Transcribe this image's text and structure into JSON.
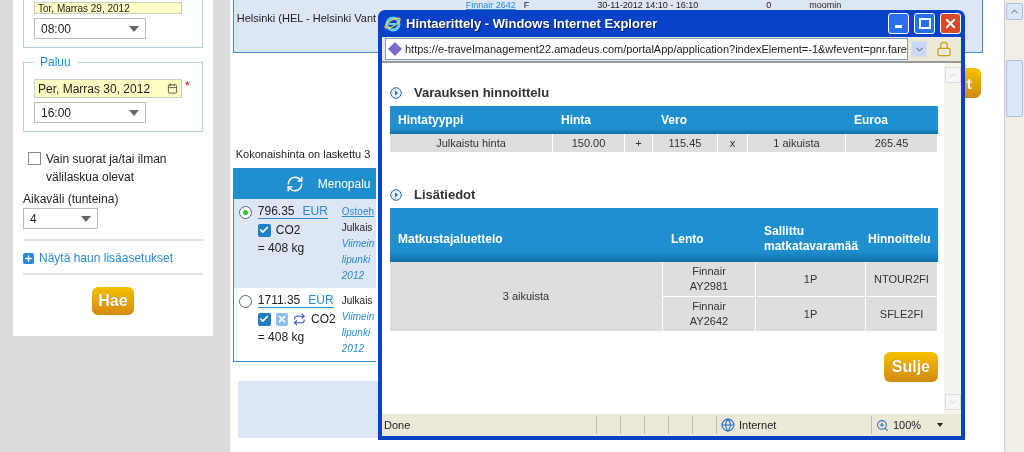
{
  "search_panel": {
    "departure": {
      "date": "Tor, Marras 29, 2012",
      "time": "08:00"
    },
    "return": {
      "legend": "Paluu",
      "date": "Per, Marras 30, 2012",
      "required_mark": "*",
      "time": "16:00"
    },
    "direct_only": {
      "label": "Vain suorat ja/tai ilman välilaskua olevat",
      "checked": false
    },
    "interval": {
      "label": "Aikaväli (tunteina)",
      "value": "4"
    },
    "advanced_link": "Näytä haun lisäasetukset",
    "search_button": "Hae"
  },
  "results": {
    "top_row": {
      "flight": "Finnair 2642",
      "class": "F",
      "time": "30-11-2012  14:10 - 16:10",
      "stops": "0",
      "user": "moomin"
    },
    "route": "Helsinki (HEL - Helsinki Vant",
    "side_button": "t",
    "total_note": "Kokonaishinta on laskettu 3",
    "header": "Menopalu",
    "offers": [
      {
        "selected": true,
        "price": "796.35",
        "currency": "EUR",
        "badges": [
          {
            "kind": "check"
          }
        ],
        "co2": "CO2",
        "weight": "= 408 kg",
        "lines": [
          {
            "kind": "link",
            "text": "Ostoeh"
          },
          {
            "kind": "plain",
            "text": "Julkais"
          },
          {
            "kind": "note",
            "text": "Viimein"
          },
          {
            "kind": "note",
            "text": "lipunki"
          },
          {
            "kind": "note",
            "text": "2012"
          }
        ]
      },
      {
        "selected": false,
        "price": "1711.35",
        "currency": "EUR",
        "badges": [
          {
            "kind": "check"
          },
          {
            "kind": "cross"
          },
          {
            "kind": "swap"
          }
        ],
        "co2": "CO2",
        "weight": "= 408 kg",
        "lines": [
          {
            "kind": "plain",
            "text": "Julkais"
          },
          {
            "kind": "note",
            "text": "Viimein"
          },
          {
            "kind": "note",
            "text": "lipunki"
          },
          {
            "kind": "note",
            "text": "2012"
          }
        ]
      }
    ]
  },
  "popup": {
    "title": "Hintaerittely - Windows Internet Explorer",
    "url": "https://e-travelmanagement22.amadeus.com/portalApp/application?indexElement=-1&wfevent=pnr.fare",
    "pricing": {
      "title": "Varauksen hinnoittelu",
      "columns": [
        "Hintatyyppi",
        "Hinta",
        "",
        "Vero",
        "",
        "",
        "Euroa"
      ],
      "rows": [
        [
          "Julkaistu hinta",
          "150.00",
          "+",
          "115.45",
          "x",
          "1  aikuista",
          "265.45"
        ]
      ]
    },
    "details": {
      "title": "Lisätiedot",
      "columns": [
        "Matkustajaluettelo",
        "Lento",
        "Sallittu matkatavaramää",
        "Hinnoittelu"
      ],
      "passengers": "3  aikuista",
      "segments": [
        {
          "flight": "Finnair AY2981",
          "baggage": "1P",
          "fare": "NTOUR2FI"
        },
        {
          "flight": "Finnair AY2642",
          "baggage": "1P",
          "fare": "SFLE2FI"
        }
      ]
    },
    "close_button": "Sulje",
    "status_bar": {
      "text": "Done",
      "zone": "Internet",
      "zoom": "100%"
    }
  }
}
